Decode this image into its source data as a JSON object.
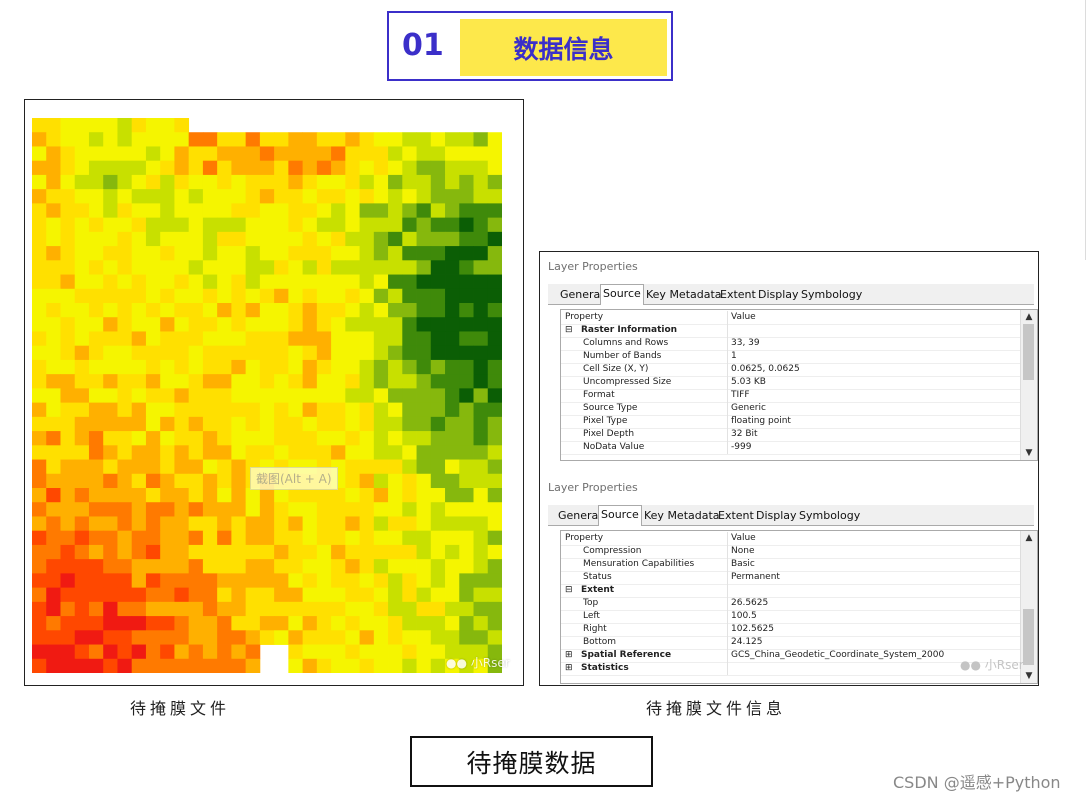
{
  "header": {
    "number": "01",
    "title": "数据信息",
    "accent": "#3b2fc9",
    "tag_bg": "#fde84b"
  },
  "map": {
    "hint_text": "截图(Alt + A)",
    "watermark": "小Rser",
    "caption": "待掩膜文件",
    "palette": [
      "#0b5e05",
      "#3f8a0a",
      "#86b80d",
      "#c8e000",
      "#f5f500",
      "#ffe000",
      "#ffb000",
      "#ff7a00",
      "#ff4800",
      "#f01a12"
    ]
  },
  "dialog1": {
    "title": "Layer Properties",
    "tabs": [
      "General",
      "Source",
      "Key Metadata",
      "Extent",
      "Display",
      "Symbology"
    ],
    "active_tab": "Source",
    "header_row": {
      "key": "Property",
      "value": "Value"
    },
    "rows": [
      {
        "toggle": "⊟",
        "key": "Raster Information",
        "value": ""
      },
      {
        "key": "Columns and Rows",
        "value": "33, 39"
      },
      {
        "key": "Number of Bands",
        "value": "1"
      },
      {
        "key": "Cell Size (X, Y)",
        "value": "0.0625, 0.0625"
      },
      {
        "key": "Uncompressed Size",
        "value": "5.03 KB"
      },
      {
        "key": "Format",
        "value": "TIFF"
      },
      {
        "key": "Source Type",
        "value": "Generic"
      },
      {
        "key": "Pixel Type",
        "value": "floating point"
      },
      {
        "key": "Pixel Depth",
        "value": "32 Bit"
      },
      {
        "key": "NoData Value",
        "value": "-999"
      }
    ]
  },
  "dialog2": {
    "title": "Layer Properties",
    "tabs": [
      "General",
      "Source",
      "Key Metadata",
      "Extent",
      "Display",
      "Symbology"
    ],
    "active_tab": "Source",
    "header_row": {
      "key": "Property",
      "value": "Value"
    },
    "rows": [
      {
        "key": "Compression",
        "value": "None"
      },
      {
        "key": "Mensuration Capabilities",
        "value": "Basic"
      },
      {
        "key": "Status",
        "value": "Permanent"
      },
      {
        "toggle": "⊟",
        "key": "Extent",
        "value": ""
      },
      {
        "key": "Top",
        "value": "26.5625"
      },
      {
        "key": "Left",
        "value": "100.5"
      },
      {
        "key": "Right",
        "value": "102.5625"
      },
      {
        "key": "Bottom",
        "value": "24.125"
      },
      {
        "toggle": "⊞",
        "key": "Spatial Reference",
        "value": "GCS_China_Geodetic_Coordinate_System_2000"
      },
      {
        "toggle": "⊞",
        "key": "Statistics",
        "value": ""
      }
    ],
    "watermark": "小Rser"
  },
  "props_caption": "待掩膜文件信息",
  "footer": {
    "label": "待掩膜数据",
    "credit": "CSDN @遥感+Python"
  }
}
